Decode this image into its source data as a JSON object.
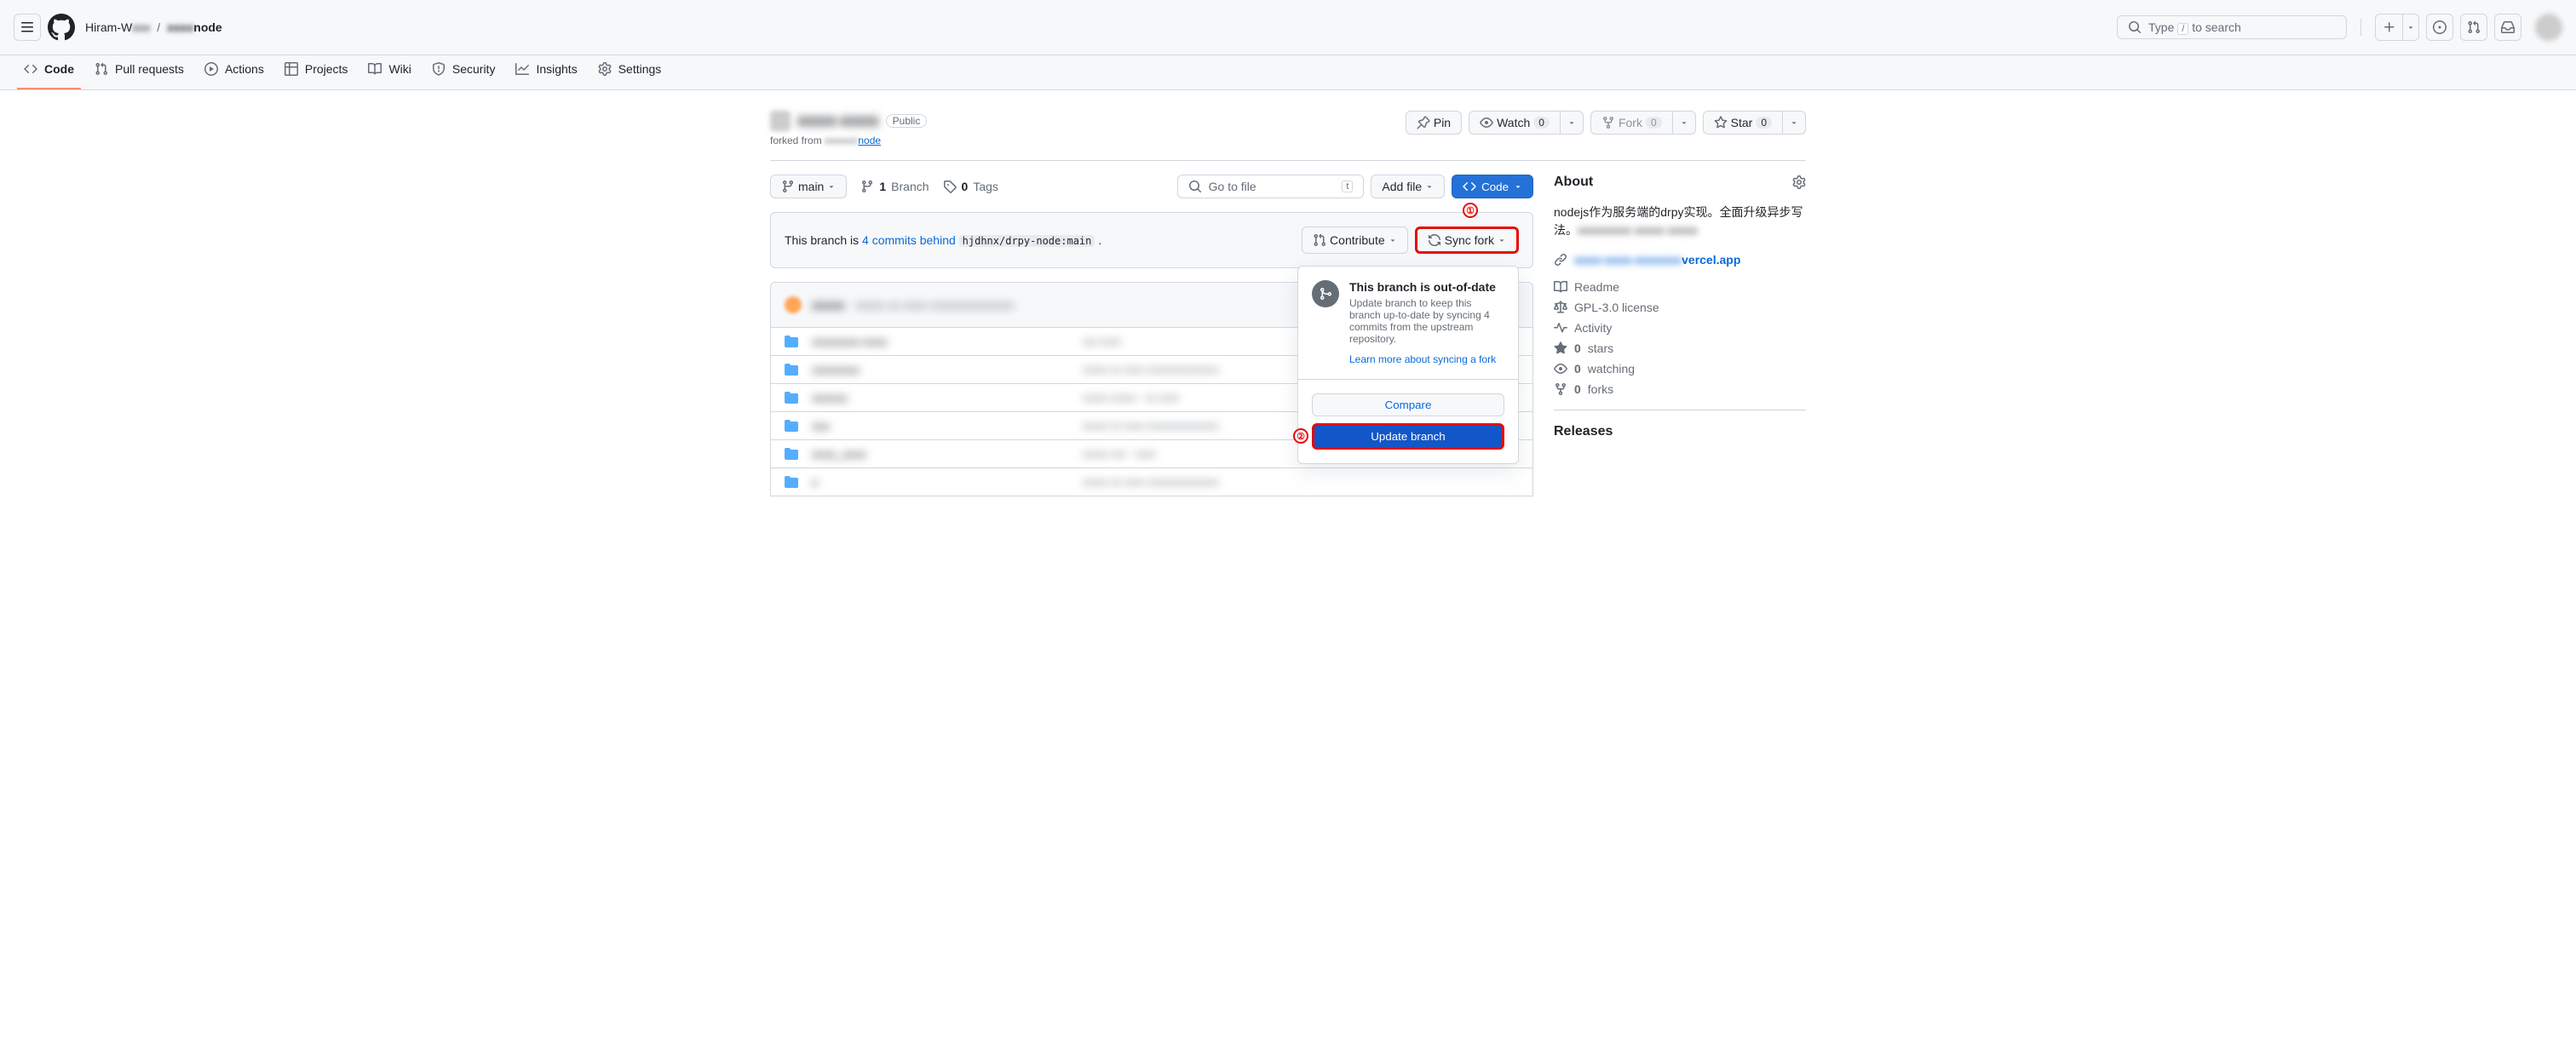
{
  "topbar": {
    "owner": "Hiram-W",
    "owner_blur": "xxx",
    "slash": "/",
    "repo_blur": "xxxx",
    "repo": "node",
    "search_prefix": "Type",
    "search_key": "/",
    "search_suffix": "to search"
  },
  "nav": {
    "code": "Code",
    "pulls": "Pull requests",
    "actions": "Actions",
    "projects": "Projects",
    "wiki": "Wiki",
    "security": "Security",
    "insights": "Insights",
    "settings": "Settings"
  },
  "repo_header": {
    "title": "xxxx-xxxx",
    "public": "Public",
    "forked_prefix": "forked from ",
    "forked_blur": "xxxxxx/",
    "forked_link": "node",
    "pin": "Pin",
    "watch": "Watch",
    "watch_count": "0",
    "fork": "Fork",
    "fork_count": "0",
    "star": "Star",
    "star_count": "0"
  },
  "toolbar": {
    "branch": "main",
    "branches_n": "1",
    "branches_l": "Branch",
    "tags_n": "0",
    "tags_l": "Tags",
    "goto": "Go to file",
    "goto_key": "t",
    "addfile": "Add file",
    "code": "Code"
  },
  "sync_banner": {
    "prefix": "This branch is ",
    "link": "4 commits behind",
    "code": "hjdhnx/drpy-node:main",
    "suffix": " .",
    "contribute": "Contribute",
    "sync_fork": "Sync fork"
  },
  "annotations": {
    "one": "①",
    "two": "②"
  },
  "popover": {
    "title": "This branch is out-of-date",
    "desc": "Update branch to keep this branch up-to-date by syncing 4 commits from the upstream repository.",
    "learn": "Learn more about syncing a fork",
    "compare": "Compare",
    "update": "Update branch"
  },
  "files": {
    "header_author": "xxxxx",
    "header_msg": "xxxxx xx xxxx xxxxxxxxxxxxxx",
    "rows": [
      {
        "name": "xxxxxxxx-xxxx",
        "msg": "xxx xxxx"
      },
      {
        "name": "xxxxxxxx",
        "msg": "xxxxx xx xxxx xxxxxxxxxxxxxx"
      },
      {
        "name": "xxxxxx",
        "msg": "xxxxx xxxxx · xx xxxx"
      },
      {
        "name": "xxx",
        "msg": "xxxxx xx xxxx xxxxxxxxxxxxxx"
      },
      {
        "name": "xxxx_xxxx",
        "msg": "xxxxx xxx · xxxx"
      },
      {
        "name": "x",
        "msg": "xxxxx xx xxxx xxxxxxxxxxxxxx"
      }
    ]
  },
  "about": {
    "title": "About",
    "desc_visible": "nodejs作为服务端的drpy实现。全面升级异步写法。",
    "desc_blur": "xxxxxxxxx xxxxx xxxxx",
    "link_blur": "xxxx-xxxx-xxxxxxx",
    "link_tail": "vercel.app",
    "readme": "Readme",
    "license": "GPL-3.0 license",
    "activity": "Activity",
    "stars_n": "0",
    "stars_l": "stars",
    "watching_n": "0",
    "watching_l": "watching",
    "forks_n": "0",
    "forks_l": "forks",
    "releases": "Releases"
  }
}
